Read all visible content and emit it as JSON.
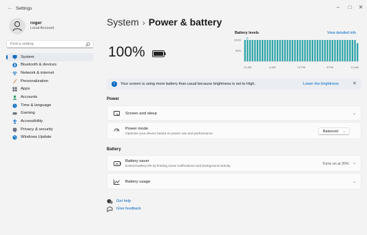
{
  "titlebar": {
    "back_icon": "back-arrow-icon",
    "title": "Settings",
    "minimize": "–",
    "maximize": "□",
    "close": "✕"
  },
  "profile": {
    "name": "roger",
    "account": "Local Account"
  },
  "search": {
    "placeholder": "Find a setting"
  },
  "nav": {
    "items": [
      {
        "label": "System",
        "icon": "system-icon",
        "active": true,
        "color": "#0067c0"
      },
      {
        "label": "Bluetooth & devices",
        "icon": "bluetooth-icon",
        "active": false,
        "color": "#0067c0"
      },
      {
        "label": "Network & internet",
        "icon": "network-icon",
        "active": false,
        "color": "#0067c0"
      },
      {
        "label": "Personalization",
        "icon": "personalization-icon",
        "active": false,
        "color": "#c47a2c"
      },
      {
        "label": "Apps",
        "icon": "apps-icon",
        "active": false,
        "color": "#5a5f6a"
      },
      {
        "label": "Accounts",
        "icon": "accounts-icon",
        "active": false,
        "color": "#2a9d6a"
      },
      {
        "label": "Time & language",
        "icon": "time-language-icon",
        "active": false,
        "color": "#0067c0"
      },
      {
        "label": "Gaming",
        "icon": "gaming-icon",
        "active": false,
        "color": "#6b7280"
      },
      {
        "label": "Accessibility",
        "icon": "accessibility-icon",
        "active": false,
        "color": "#0067c0"
      },
      {
        "label": "Privacy & security",
        "icon": "shield-icon",
        "active": false,
        "color": "#6b7280"
      },
      {
        "label": "Windows Update",
        "icon": "windows-update-icon",
        "active": false,
        "color": "#0067c0"
      }
    ]
  },
  "main": {
    "breadcrumb_parent": "System",
    "breadcrumb_sep": "›",
    "page_title": "Power & battery",
    "battery_percent": "100%",
    "battery_level": 1.0
  },
  "chart": {
    "title": "Battery levels",
    "link": "View detailed info",
    "y_labels": [
      "100%",
      "50%"
    ],
    "x_labels": [
      "12 AM",
      "6 AM",
      "12 PM",
      "6 PM",
      "12 AM"
    ],
    "accent": "#2ca3a8"
  },
  "chart_data": {
    "type": "bar",
    "title": "Battery levels",
    "xlabel": "",
    "ylabel": "",
    "ylim": [
      0,
      100
    ],
    "x_ticks": [
      "12 AM",
      "6 AM",
      "12 PM",
      "6 PM",
      "12 AM"
    ],
    "values": [
      100,
      100,
      100,
      100,
      100,
      100,
      100,
      100,
      100,
      100,
      100,
      100,
      100,
      100,
      100,
      100,
      100,
      100,
      100,
      100,
      100,
      100,
      100,
      100,
      100,
      100,
      100,
      100,
      100,
      100,
      100,
      100,
      100,
      100,
      100,
      100,
      100,
      100,
      100,
      100,
      100,
      100,
      100,
      100,
      100,
      85
    ],
    "grid": true
  },
  "banner": {
    "text": "Your screen is using more battery than usual because brightness is set to High.",
    "action": "Lower the brightness",
    "close": "✕"
  },
  "sections": {
    "power": "Power",
    "battery": "Battery"
  },
  "cards": {
    "screen_sleep": {
      "title": "Screen and sleep"
    },
    "power_mode": {
      "title": "Power mode",
      "desc": "Optimize your device based on power use and performance",
      "value": "Balanced"
    },
    "battery_saver": {
      "title": "Battery saver",
      "desc": "Extend battery life by limiting some notifications and background activity",
      "status": "Turns on at 20%"
    },
    "battery_usage": {
      "title": "Battery usage"
    }
  },
  "links": {
    "help": "Get help",
    "feedback": "Give feedback"
  }
}
